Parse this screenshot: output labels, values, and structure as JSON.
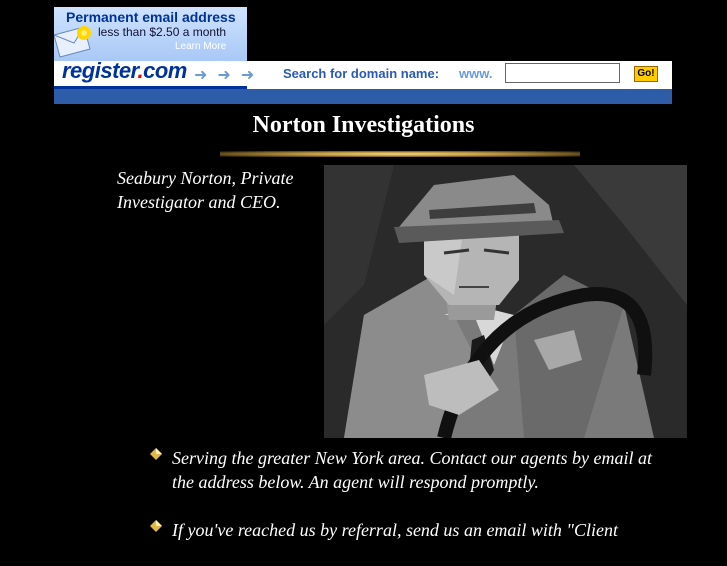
{
  "banner": {
    "ad_title": "Permanent email address",
    "ad_subtitle": "less than $2.50 a month",
    "ad_link": "Learn More",
    "logo_name": "register",
    "logo_dot": ".",
    "logo_tld": "com",
    "search_label": "Search for domain name:",
    "www_prefix": "www.",
    "domain_value": "",
    "go_label": "Go!",
    "colors": {
      "brand_blue": "#003399",
      "strip_blue": "#2d5ca8",
      "go_yellow": "#ffcc00"
    }
  },
  "header": {
    "title": "Norton Investigations"
  },
  "profile": {
    "caption": "Seabury Norton, Private Investigator and CEO.",
    "photo_icon": "detective-photo"
  },
  "bullets": [
    {
      "text": "Serving the greater New York area. Contact our agents by email at the address below. An agent will respond promptly."
    },
    {
      "text": "If you've reached us by referral, send us an email with \"Client"
    }
  ],
  "colors": {
    "background": "#000000",
    "text": "#ffffff",
    "gold_rule": "#c7a24a"
  }
}
